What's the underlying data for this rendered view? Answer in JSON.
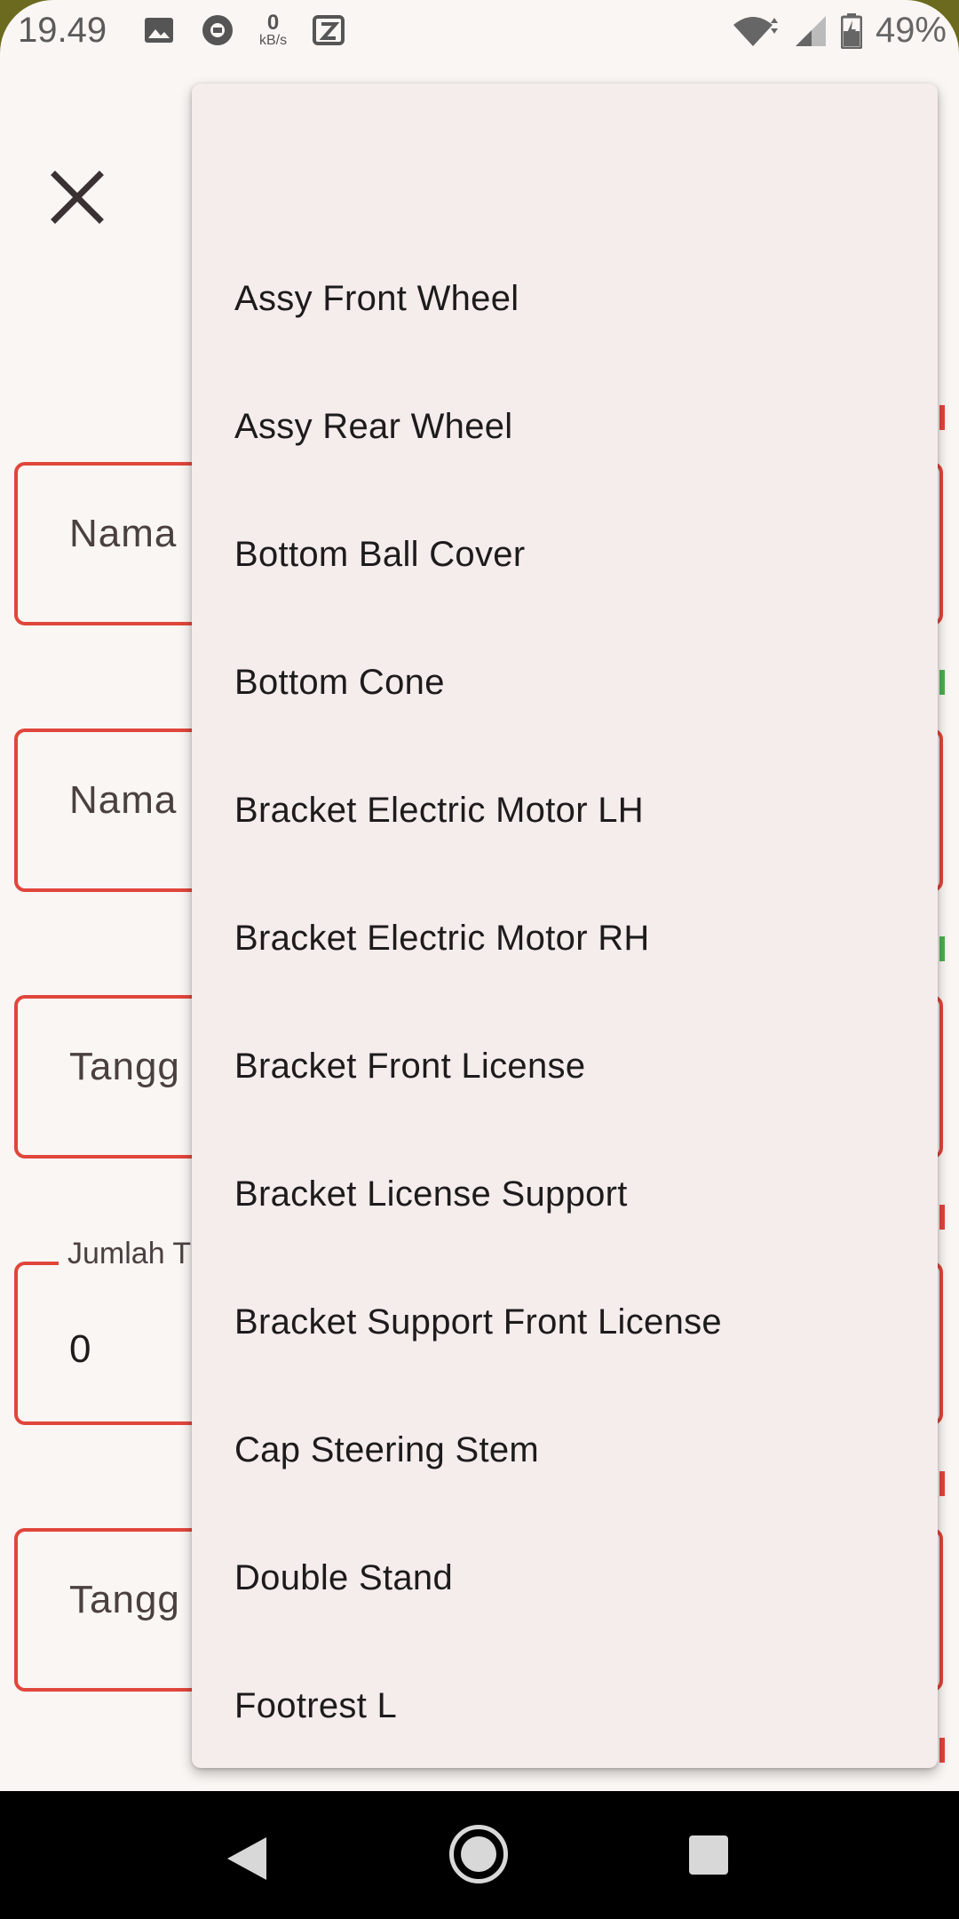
{
  "status_bar": {
    "time": "19.49",
    "net_speed_value": "0",
    "net_speed_unit": "kB/s",
    "battery_percent": "49%",
    "icons": [
      "image-icon",
      "chat-icon",
      "netspeed-icon",
      "app-icon",
      "wifi-icon",
      "signal-icon",
      "battery-icon"
    ]
  },
  "form": {
    "close_icon": "close-icon",
    "fields": [
      {
        "label": "Nama"
      },
      {
        "label": "Nama"
      },
      {
        "label": "Tangg"
      },
      {
        "floating_label": "Jumlah T",
        "value": "0"
      },
      {
        "label": "Tangg"
      }
    ]
  },
  "dropdown": {
    "items": [
      "Assy Front Wheel",
      "Assy Rear Wheel",
      "Bottom Ball Cover",
      "Bottom Cone",
      "Bracket Electric Motor LH",
      "Bracket Electric Motor RH",
      "Bracket Front License",
      "Bracket License Support",
      "Bracket Support Front License",
      "Cap Steering Stem",
      "Double Stand",
      "Footrest L"
    ]
  },
  "nav_bar": {
    "icons": [
      "back-icon",
      "home-icon",
      "recents-icon"
    ]
  },
  "colors": {
    "error": "#e0463c",
    "ok": "#4caf50",
    "menu_bg": "#f5ecec",
    "page_bg": "#faf6f3"
  }
}
